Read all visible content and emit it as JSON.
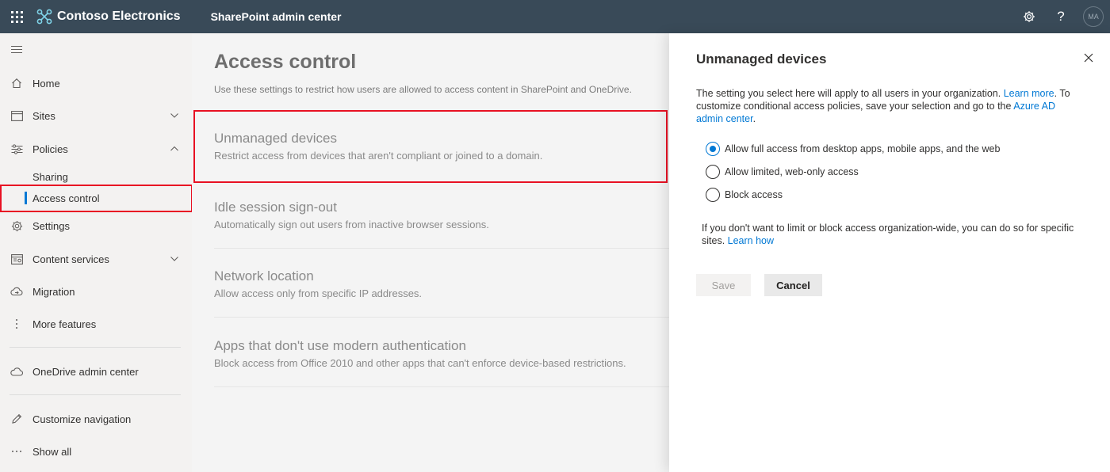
{
  "topbar": {
    "brand": "Contoso Electronics",
    "app": "SharePoint admin center",
    "avatar_initials": "MA"
  },
  "nav": {
    "items": [
      {
        "label": "Home",
        "icon": "home-icon"
      },
      {
        "label": "Sites",
        "icon": "sites-icon"
      },
      {
        "label": "Policies",
        "icon": "policies-icon"
      },
      {
        "label": "Sharing"
      },
      {
        "label": "Access control"
      },
      {
        "label": "Settings",
        "icon": "gear-icon"
      },
      {
        "label": "Content services",
        "icon": "content-services-icon"
      },
      {
        "label": "Migration",
        "icon": "cloud-migration-icon"
      },
      {
        "label": "More features",
        "icon": "more-vertical-icon"
      },
      {
        "label": "OneDrive admin center",
        "icon": "onedrive-icon"
      },
      {
        "label": "Customize navigation",
        "icon": "pencil-icon"
      },
      {
        "label": "Show all",
        "icon": "ellipsis-icon"
      }
    ]
  },
  "main": {
    "title": "Access control",
    "description": "Use these settings to restrict how users are allowed to access content in SharePoint and OneDrive.",
    "settings": [
      {
        "title": "Unmanaged devices",
        "desc": "Restrict access from devices that aren't compliant or joined to a domain."
      },
      {
        "title": "Idle session sign-out",
        "desc": "Automatically sign out users from inactive browser sessions."
      },
      {
        "title": "Network location",
        "desc": "Allow access only from specific IP addresses."
      },
      {
        "title": "Apps that don't use modern authentication",
        "desc": "Block access from Office 2010 and other apps that can't enforce device-based restrictions."
      }
    ]
  },
  "panel": {
    "title": "Unmanaged devices",
    "intro_1": "The setting you select here will apply to all users in your organization. ",
    "intro_link_1": "Learn more",
    "intro_2": ". To customize conditional access policies, save your selection and go to the ",
    "intro_link_2": "Azure AD admin center",
    "intro_3": ".",
    "options": [
      {
        "label": "Allow full access from desktop apps, mobile apps, and the web",
        "checked": true
      },
      {
        "label": "Allow limited, web-only access",
        "checked": false
      },
      {
        "label": "Block access",
        "checked": false
      }
    ],
    "note": "If you don't want to limit or block access organization-wide, you can do so for specific sites. ",
    "note_link": "Learn how",
    "save_label": "Save",
    "cancel_label": "Cancel"
  },
  "colors": {
    "topbar": "#394a58",
    "accent": "#0078d4",
    "highlight": "#e81123"
  }
}
